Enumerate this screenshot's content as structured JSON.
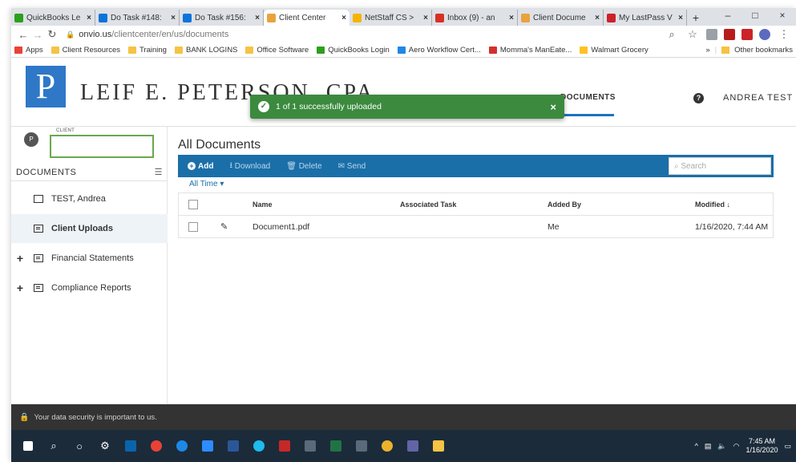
{
  "browser": {
    "tabs": [
      {
        "title": "QuickBooks Le",
        "color": "#2ca01c"
      },
      {
        "title": "Do Task #148:",
        "color": "#0a74da"
      },
      {
        "title": "Do Task #156:",
        "color": "#0a74da"
      },
      {
        "title": "Client Center",
        "color": "#e8a33d",
        "active": true
      },
      {
        "title": "NetStaff CS >",
        "color": "#f5b400"
      },
      {
        "title": "Inbox (9) - an",
        "color": "#d93025"
      },
      {
        "title": "Client Docume",
        "color": "#e8a33d"
      },
      {
        "title": "My LastPass V",
        "color": "#cc2229"
      }
    ],
    "new_tab": "+",
    "window_controls": [
      "–",
      "□",
      "×"
    ],
    "url_host": "onvio.us",
    "url_path": "/clientcenter/en/us/documents",
    "bookmarks": [
      {
        "label": "Apps",
        "color": "#e94235"
      },
      {
        "label": "Client Resources",
        "color": "#f6c343"
      },
      {
        "label": "Training",
        "color": "#f6c343"
      },
      {
        "label": "BANK LOGINS",
        "color": "#f6c343"
      },
      {
        "label": "Office Software",
        "color": "#f6c343"
      },
      {
        "label": "QuickBooks Login",
        "color": "#2ca01c"
      },
      {
        "label": "Aero Workflow Cert...",
        "color": "#1e88e5"
      },
      {
        "label": "Momma's ManEate...",
        "color": "#d32f2f"
      },
      {
        "label": "Walmart Grocery",
        "color": "#ffc220"
      }
    ],
    "bookmarks_overflow": "»",
    "other_bookmarks": "Other bookmarks"
  },
  "app": {
    "logo_letter": "P",
    "firm_name": "LEIF E. PETERSON, CPA",
    "active_tab": "DOCUMENTS",
    "help": "?",
    "user_name": "ANDREA TEST",
    "accent": "#1a6fa8"
  },
  "toast": {
    "message": "1 of 1 successfully uploaded",
    "close": "×",
    "color": "#3b8a3e"
  },
  "sidebar": {
    "avatar_initial": "P",
    "client_label": "CLIENT",
    "documents_header": "DOCUMENTS",
    "items": [
      {
        "label": "TEST, Andrea",
        "expander": "",
        "icon": "folder-icon"
      },
      {
        "label": "Client Uploads",
        "expander": "",
        "icon": "document-folder-icon",
        "selected": true
      },
      {
        "label": "Financial Statements",
        "expander": "+",
        "icon": "document-folder-icon"
      },
      {
        "label": "Compliance Reports",
        "expander": "+",
        "icon": "document-folder-icon"
      }
    ]
  },
  "main": {
    "title": "All Documents",
    "toolbar": {
      "add": "Add",
      "download": "Download",
      "delete": "Delete",
      "send": "Send",
      "search_placeholder": "Search"
    },
    "filter": "All Time",
    "columns": {
      "name": "Name",
      "task": "Associated Task",
      "added_by": "Added By",
      "modified": "Modified ↓"
    },
    "rows": [
      {
        "name": "Document1.pdf",
        "task": "",
        "added_by": "Me",
        "modified": "1/16/2020, 7:44 AM"
      }
    ]
  },
  "security_notice": "Your data security is important to us.",
  "taskbar": {
    "time": "7:45 AM",
    "date": "1/16/2020"
  }
}
